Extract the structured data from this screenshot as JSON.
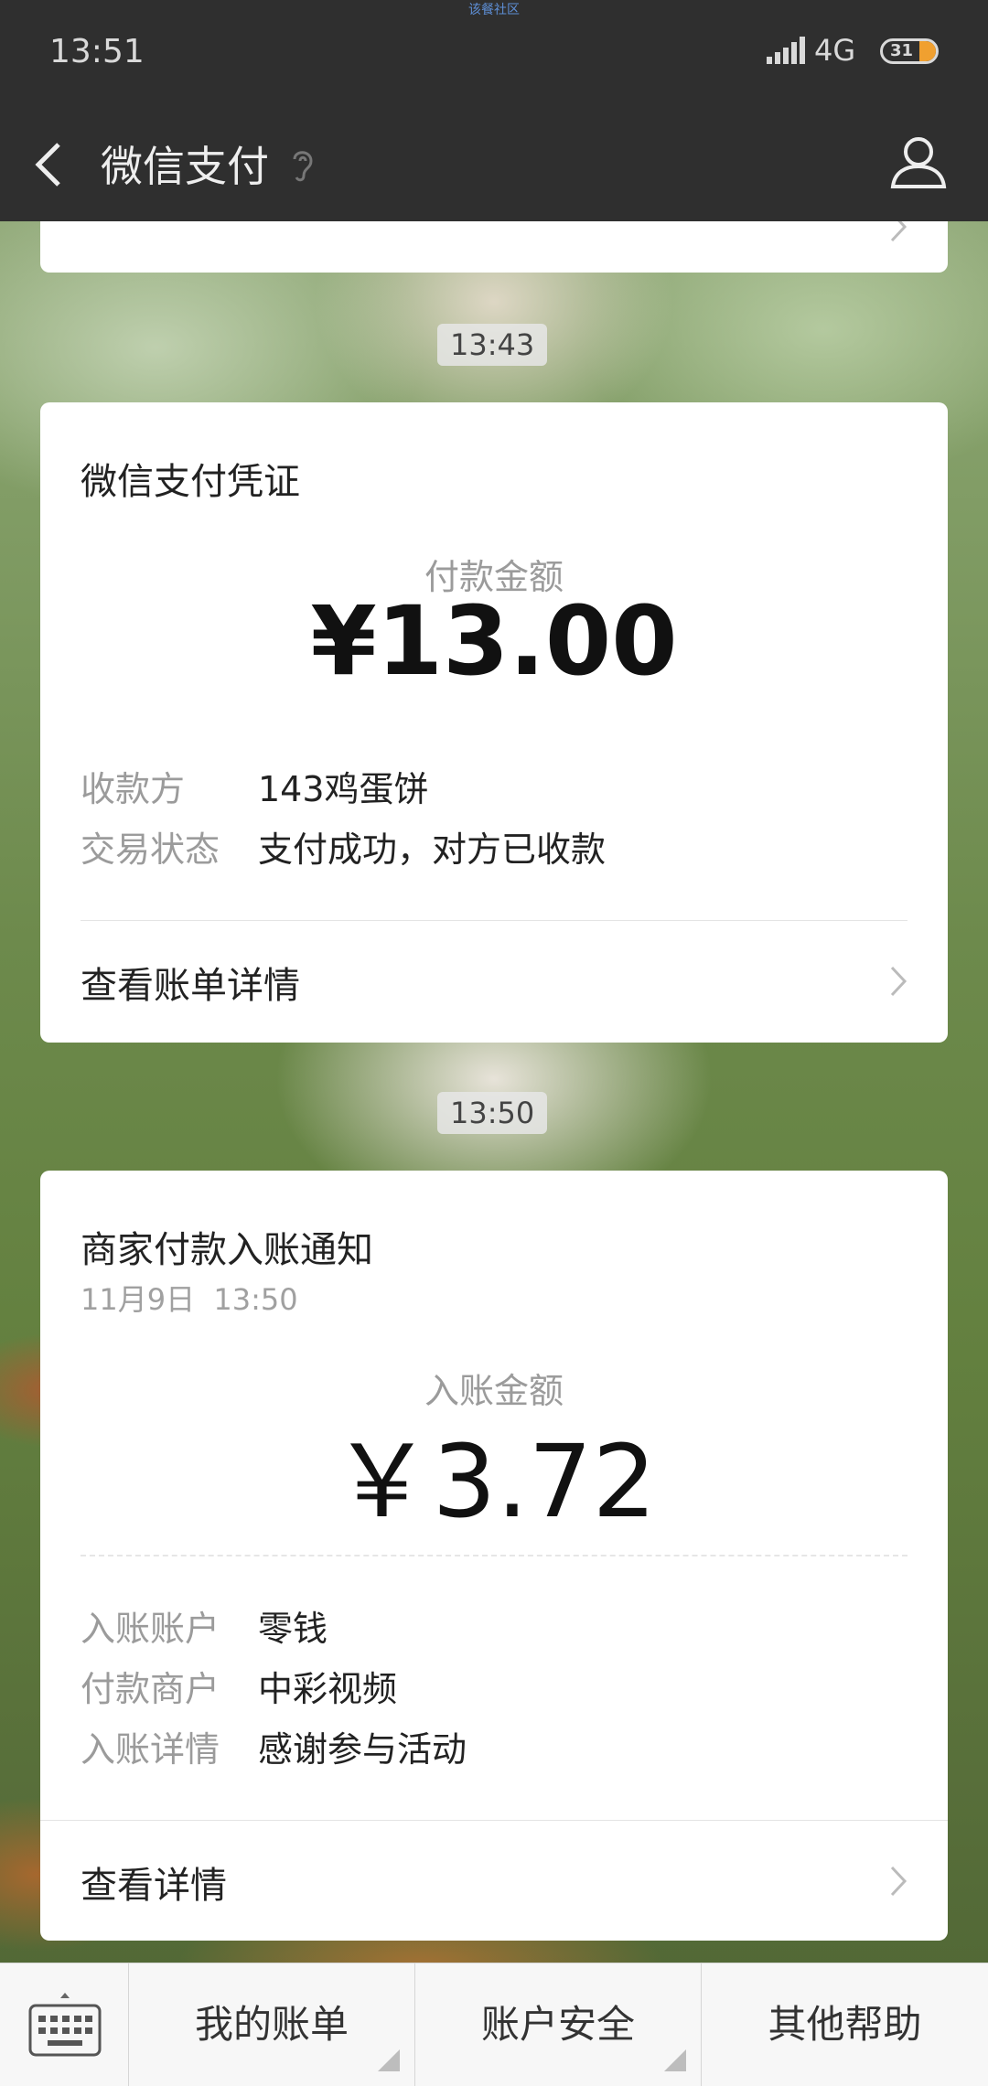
{
  "status_bar": {
    "time": "13:51",
    "tiny_label": "该餐社区",
    "network": "4G",
    "battery": "31",
    "battery_color": "#f0a030"
  },
  "nav": {
    "title": "微信支付",
    "back_icon": "back-arrow-icon",
    "ear_icon": "ear-icon",
    "profile_icon": "user-icon"
  },
  "messages": [
    {
      "time": "13:43",
      "title": "微信支付凭证",
      "amount_label": "付款金额",
      "amount": "¥13.00",
      "rows": [
        {
          "label": "收款方",
          "value": "143鸡蛋饼"
        },
        {
          "label": "交易状态",
          "value": "支付成功，对方已收款"
        }
      ],
      "link": "查看账单详情"
    },
    {
      "time": "13:50",
      "title": "商家付款入账通知",
      "date": "11月9日  13:50",
      "amount_label": "入账金额",
      "amount": "￥3.72",
      "rows": [
        {
          "label": "入账账户",
          "value": "零钱"
        },
        {
          "label": "付款商户",
          "value": "中彩视频"
        },
        {
          "label": "入账详情",
          "value": "感谢参与活动"
        }
      ],
      "link": "查看详情"
    }
  ],
  "bottom_menu": {
    "keyboard_icon": "keyboard-icon",
    "tabs": [
      "我的账单",
      "账户安全",
      "其他帮助"
    ]
  }
}
